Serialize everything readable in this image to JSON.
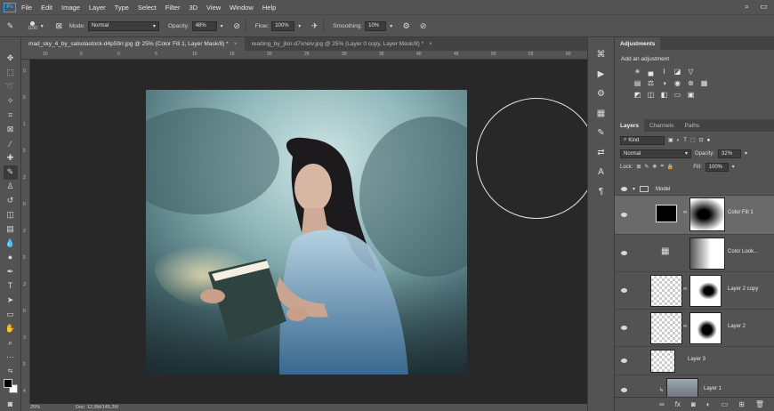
{
  "menubar": {
    "logo": "Ps",
    "items": [
      "File",
      "Edit",
      "Image",
      "Layer",
      "Type",
      "Select",
      "Filter",
      "3D",
      "View",
      "Window",
      "Help"
    ]
  },
  "options": {
    "brush_size": "1100",
    "mode_label": "Mode:",
    "mode_value": "Normal",
    "opacity_label": "Opacity:",
    "opacity_value": "48%",
    "flow_label": "Flow:",
    "flow_value": "100%",
    "smoothing_label": "Smoothing:",
    "smoothing_value": "10%"
  },
  "tabs": [
    {
      "label": "mad_sky_4_by_salsolastock-d4p59rr.jpg @ 25% (Color Fill 1, Layer Mask/8) *",
      "close": "×"
    },
    {
      "label": "reading_by_jlior-d7xnelv.jpg @ 25% (Layer 0 copy, Layer Mask/8) *",
      "close": "×"
    }
  ],
  "ruler_h": [
    "10",
    "5",
    "0",
    "5",
    "10",
    "15",
    "20",
    "25",
    "30",
    "35",
    "40",
    "45",
    "50",
    "55",
    "60"
  ],
  "ruler_v": [
    "0",
    "5",
    "1",
    "5",
    "2",
    "0",
    "2",
    "5",
    "3",
    "0",
    "3",
    "5",
    "4"
  ],
  "status": {
    "zoom": "25%",
    "doc": "Doc: 12,9M/145,2M"
  },
  "adjustments": {
    "tab": "Adjustments",
    "title": "Add an adjustment"
  },
  "layers_panel": {
    "tabs": [
      "Layers",
      "Channels",
      "Paths"
    ],
    "kind_label": "Kind",
    "blend_mode": "Normal",
    "opacity_label": "Opacity:",
    "opacity_value": "32%",
    "lock_label": "Lock:",
    "fill_label": "Fill:",
    "fill_value": "100%",
    "group_name": "Model",
    "layers": [
      {
        "name": "Color Fill 1"
      },
      {
        "name": "Color Look..."
      },
      {
        "name": "Layer 2 copy"
      },
      {
        "name": "Layer 2"
      },
      {
        "name": "Layer 3"
      },
      {
        "name": "Layer 1"
      }
    ]
  },
  "colors": {
    "ui_dark": "#535353",
    "ui_darker": "#434343",
    "canvas_bg": "#282828",
    "accent": "#31a8ff"
  }
}
